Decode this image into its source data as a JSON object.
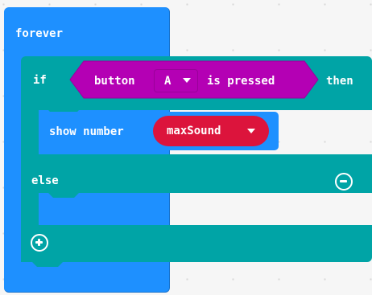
{
  "blocks": {
    "forever": {
      "label": "forever",
      "color": "#1e90ff"
    },
    "if_else": {
      "if_label": "if",
      "then_label": "then",
      "else_label": "else",
      "color": "#00a4a6"
    },
    "condition": {
      "prefix": "button",
      "button_value": "A",
      "suffix": "is pressed",
      "color": "#b400b4"
    },
    "show_number": {
      "label": "show number",
      "variable": "maxSound",
      "color": "#1e90ff",
      "variable_color": "#dc143c"
    }
  },
  "icons": {
    "remove_else": "minus-circle-icon",
    "add_else": "plus-circle-icon",
    "dropdown": "caret-down-icon"
  }
}
